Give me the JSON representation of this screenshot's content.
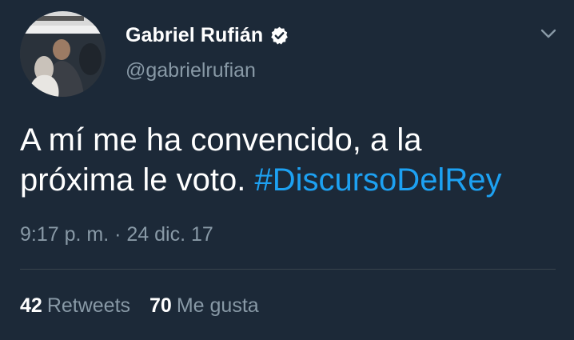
{
  "tweet": {
    "author": {
      "display_name": "Gabriel Rufián",
      "handle": "@gabrielrufian",
      "verified": true,
      "avatar_icon": "profile-photo"
    },
    "text_plain": "A mí me ha convencido, a la\npróxima le voto. ",
    "hashtag": "#DiscursoDelRey",
    "timestamp": "9:17 p. m. · 24 dic. 17",
    "stats": {
      "retweets_count": "42",
      "retweets_label": "Retweets",
      "likes_count": "70",
      "likes_label": "Me gusta"
    }
  },
  "colors": {
    "background": "#1c2938",
    "text_primary": "#ffffff",
    "text_secondary": "#8899a6",
    "link": "#1da1f2",
    "divider": "#38444d"
  }
}
